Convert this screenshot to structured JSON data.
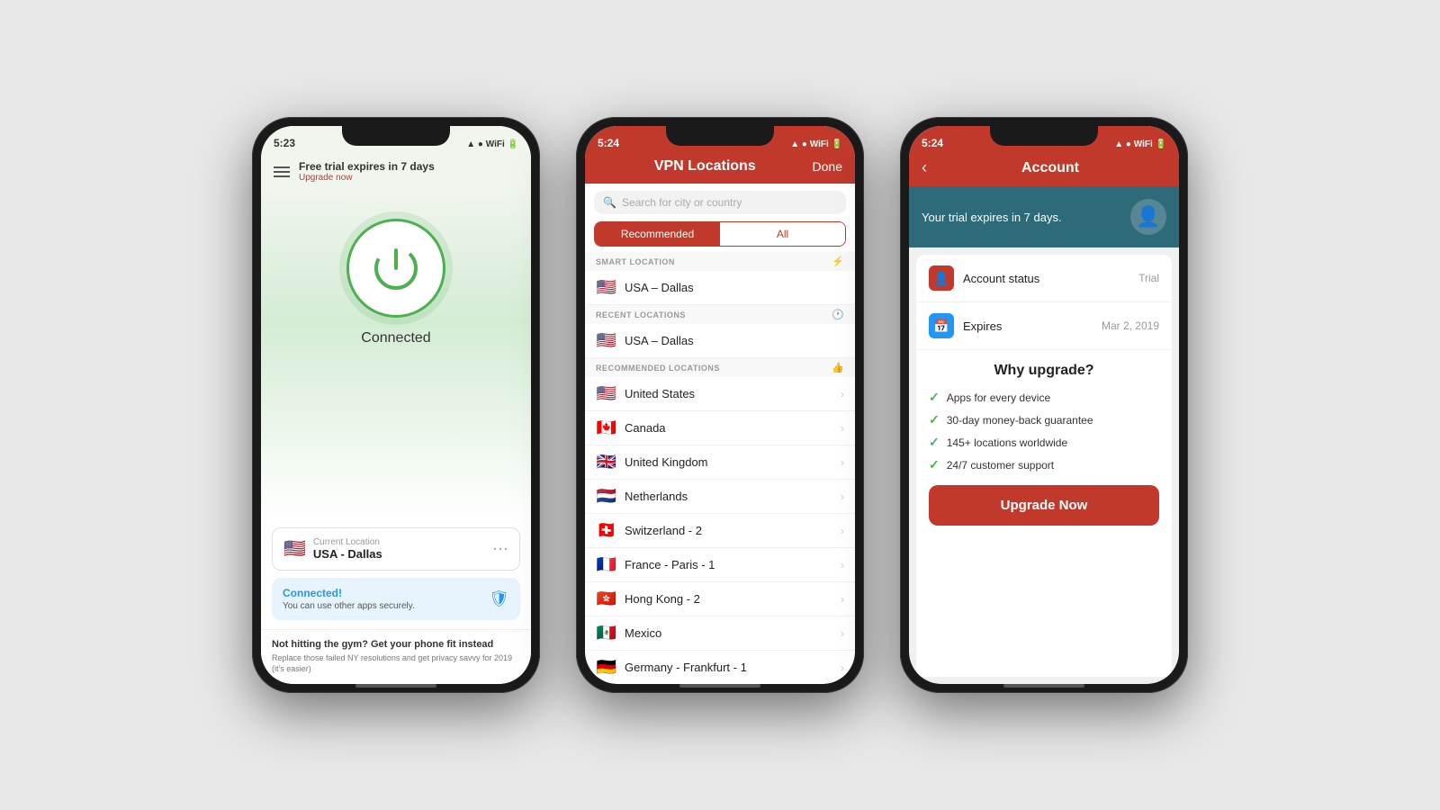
{
  "phone1": {
    "statusTime": "5:23",
    "statusIcons": "▲ ● WiFi",
    "banner": {
      "title": "Free trial expires in 7 days",
      "subtitle": "Upgrade now"
    },
    "connectedLabel": "Connected",
    "currentLocation": {
      "label": "Current Location",
      "name": "USA - Dallas"
    },
    "connectedCard": {
      "title": "Connected!",
      "subtitle": "You can use other apps securely."
    },
    "ad": {
      "title": "Not hitting the gym? Get your phone fit instead",
      "text": "Replace those failed NY resolutions and get privacy savvy for 2019 (it's easier)"
    }
  },
  "phone2": {
    "statusTime": "5:24",
    "title": "VPN Locations",
    "doneLabel": "Done",
    "searchPlaceholder": "Search for city or country",
    "tabs": [
      "Recommended",
      "All"
    ],
    "activeTab": 0,
    "smartLocation": {
      "header": "SMART LOCATION",
      "item": "USA – Dallas"
    },
    "recentLocations": {
      "header": "RECENT LOCATIONS",
      "item": "USA – Dallas"
    },
    "recommendedLocations": {
      "header": "RECOMMENDED LOCATIONS",
      "items": [
        {
          "flag": "🇺🇸",
          "name": "United States"
        },
        {
          "flag": "🇨🇦",
          "name": "Canada"
        },
        {
          "flag": "🇬🇧",
          "name": "United Kingdom"
        },
        {
          "flag": "🇳🇱",
          "name": "Netherlands"
        },
        {
          "flag": "🇨🇭",
          "name": "Switzerland - 2"
        },
        {
          "flag": "🇫🇷",
          "name": "France - Paris - 1"
        },
        {
          "flag": "🇭🇰",
          "name": "Hong Kong - 2"
        },
        {
          "flag": "🇲🇽",
          "name": "Mexico"
        },
        {
          "flag": "🇩🇪",
          "name": "Germany - Frankfurt - 1"
        }
      ]
    }
  },
  "phone3": {
    "statusTime": "5:24",
    "title": "Account",
    "heroText": "Your trial expires in 7 days.",
    "rows": [
      {
        "icon": "👤",
        "iconClass": "icon-red",
        "label": "Account status",
        "value": "Trial"
      },
      {
        "icon": "📅",
        "iconClass": "icon-blue",
        "label": "Expires",
        "value": "Mar 2, 2019"
      }
    ],
    "upgradeSection": {
      "title": "Why upgrade?",
      "features": [
        "Apps for every device",
        "30-day money-back guarantee",
        "145+ locations worldwide",
        "24/7 customer support"
      ],
      "buttonLabel": "Upgrade Now"
    }
  }
}
